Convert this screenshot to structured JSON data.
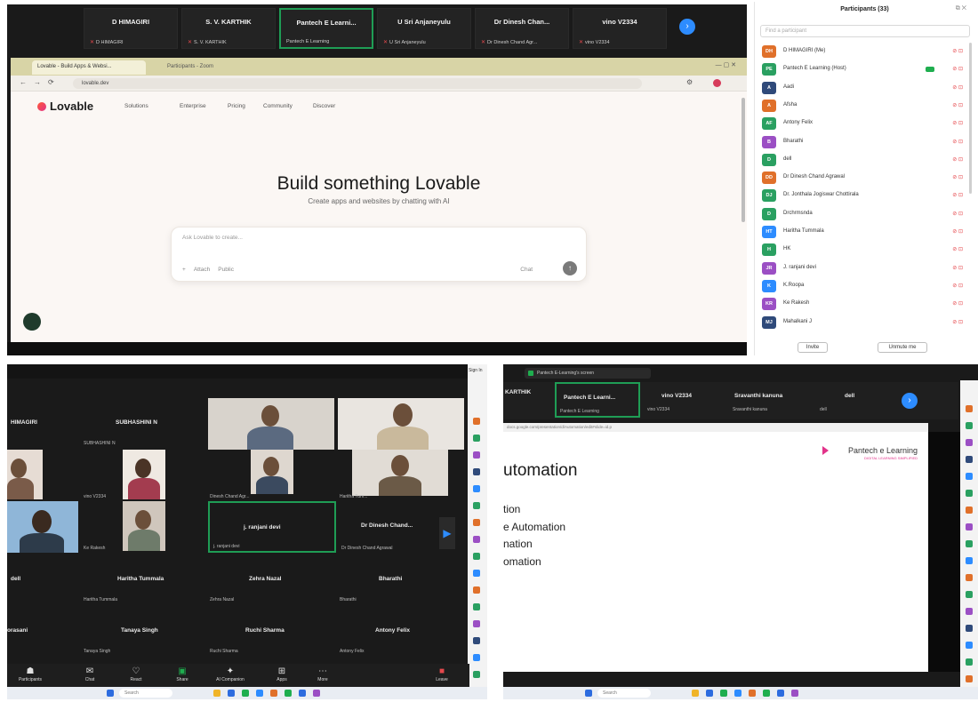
{
  "panel_a": {
    "tiles": [
      {
        "name": "D HIMAGIRI",
        "sub": "D HIMAGIRI"
      },
      {
        "name": "S. V. KARTHIK",
        "sub": "S. V. KARTHIK"
      },
      {
        "name": "Pantech E Learni...",
        "sub": "Pantech E Learning",
        "active": true
      },
      {
        "name": "U Sri Anjaneyulu",
        "sub": "U Sri Anjaneyulu"
      },
      {
        "name": "Dr Dinesh Chan...",
        "sub": "Dr Dinesh Chand Agr..."
      },
      {
        "name": "vino V2334",
        "sub": "vino V2334"
      }
    ],
    "browser": {
      "tab1": "Lovable - Build Apps & Websi...",
      "tab2": "Participants - Zoom",
      "url": "lovable.dev",
      "logo": "Lovable",
      "nav": [
        "Solutions",
        "Enterprise",
        "Pricing",
        "Community",
        "Discover"
      ],
      "hero_title": "Build something Lovable",
      "hero_sub": "Create apps and websites by chatting with AI",
      "prompt_placeholder": "Ask Lovable to create...",
      "prompt_attach": "Attach",
      "prompt_public": "Public",
      "prompt_chat": "Chat"
    }
  },
  "participants": {
    "title": "Participants (33)",
    "search_placeholder": "Find a participant",
    "list": [
      {
        "initials": "DH",
        "name": "D HIMAGIRI (Me)",
        "color": "#e0702a"
      },
      {
        "initials": "PE",
        "name": "Pantech E Learning (Host)",
        "color": "#2aa061",
        "host": true
      },
      {
        "initials": "A",
        "name": "Aadi",
        "color": "#2f4a7a"
      },
      {
        "initials": "A",
        "name": "Afsha",
        "color": "#e0702a"
      },
      {
        "initials": "AF",
        "name": "Antony Felix",
        "color": "#2aa061"
      },
      {
        "initials": "B",
        "name": "Bharathi",
        "color": "#9b4fc4"
      },
      {
        "initials": "D",
        "name": "dell",
        "color": "#2aa061"
      },
      {
        "initials": "DD",
        "name": "Dr Dinesh Chand Agrawal",
        "color": "#e0702a"
      },
      {
        "initials": "DJ",
        "name": "Dr. Jonthala Jogiswar Chottirala",
        "color": "#2aa061"
      },
      {
        "initials": "D",
        "name": "Drchrmsnda",
        "color": "#2aa061"
      },
      {
        "initials": "HT",
        "name": "Haritha Tummala",
        "color": "#2d8cff"
      },
      {
        "initials": "H",
        "name": "HK",
        "color": "#2aa061"
      },
      {
        "initials": "JR",
        "name": "J. ranjani devi",
        "color": "#9b4fc4"
      },
      {
        "initials": "K",
        "name": "K.Roopa",
        "color": "#2d8cff"
      },
      {
        "initials": "KR",
        "name": "Ke Rakesh",
        "color": "#9b4fc4"
      },
      {
        "initials": "MJ",
        "name": "Mahalkani J",
        "color": "#2f4a7a"
      }
    ],
    "invite_label": "Invite",
    "unmute_label": "Unmute me"
  },
  "panel_c": {
    "top_right": "Sign In",
    "names_row1": [
      "HIMAGIRI",
      "SUBHASHINI N"
    ],
    "sub_row1": [
      "",
      "SUBHASHINI N"
    ],
    "video_tiles_sub": [
      "",
      "",
      "vino V2334",
      "Dinesh Chand Agr...",
      "Haritha Tum...",
      "Ke Rakesh",
      "",
      "Kamesh K"
    ],
    "names_row2": [
      "j. ranjani devi",
      "Dr Dinesh Chand..."
    ],
    "sub_row2": [
      "j. ranjani devi",
      "Dr Dinesh Chand Agrawal"
    ],
    "names_row3": [
      "dell",
      "Haritha Tummala",
      "Zehra Nazal",
      "Bharathi"
    ],
    "sub_row3": [
      "Haritha Tummala",
      "Zehra Nazal",
      "Bharathi"
    ],
    "names_row4": [
      "orasani",
      "Tanaya Singh",
      "Ruchi Sharma",
      "Antony Felix"
    ],
    "sub_row4": [
      "Tanaya Singh",
      "Ruchi Sharma",
      "Antony Felix"
    ],
    "toolbar": [
      "Participants",
      "Chat",
      "React",
      "Share",
      "AI Companion",
      "Apps",
      "More",
      "Leave"
    ],
    "taskbar_search": "Search"
  },
  "panel_d": {
    "share_label": "Pantech E-Learning's screen",
    "tiles": [
      {
        "name": "KARTHIK",
        "sub": "KARTHIK"
      },
      {
        "name": "Pantech E Learni...",
        "sub": "Pantech E Learning",
        "active": true
      },
      {
        "name": "vino V2334",
        "sub": "vino V2334"
      },
      {
        "name": "Sravanthi kanuna",
        "sub": "Sravanthi kanuna"
      },
      {
        "name": "dell",
        "sub": "dell"
      }
    ],
    "url": "docs.google.com/presentation/d/Automation/edit#slide=id.p",
    "slide_title": "utomation",
    "slide_lines": [
      "tion",
      "e Automation",
      "nation",
      "omation"
    ],
    "brand": "Pantech e Learning",
    "brand_sub": "DIGITAL LEARNING SIMPLIFIED",
    "taskbar_search": "Search"
  }
}
